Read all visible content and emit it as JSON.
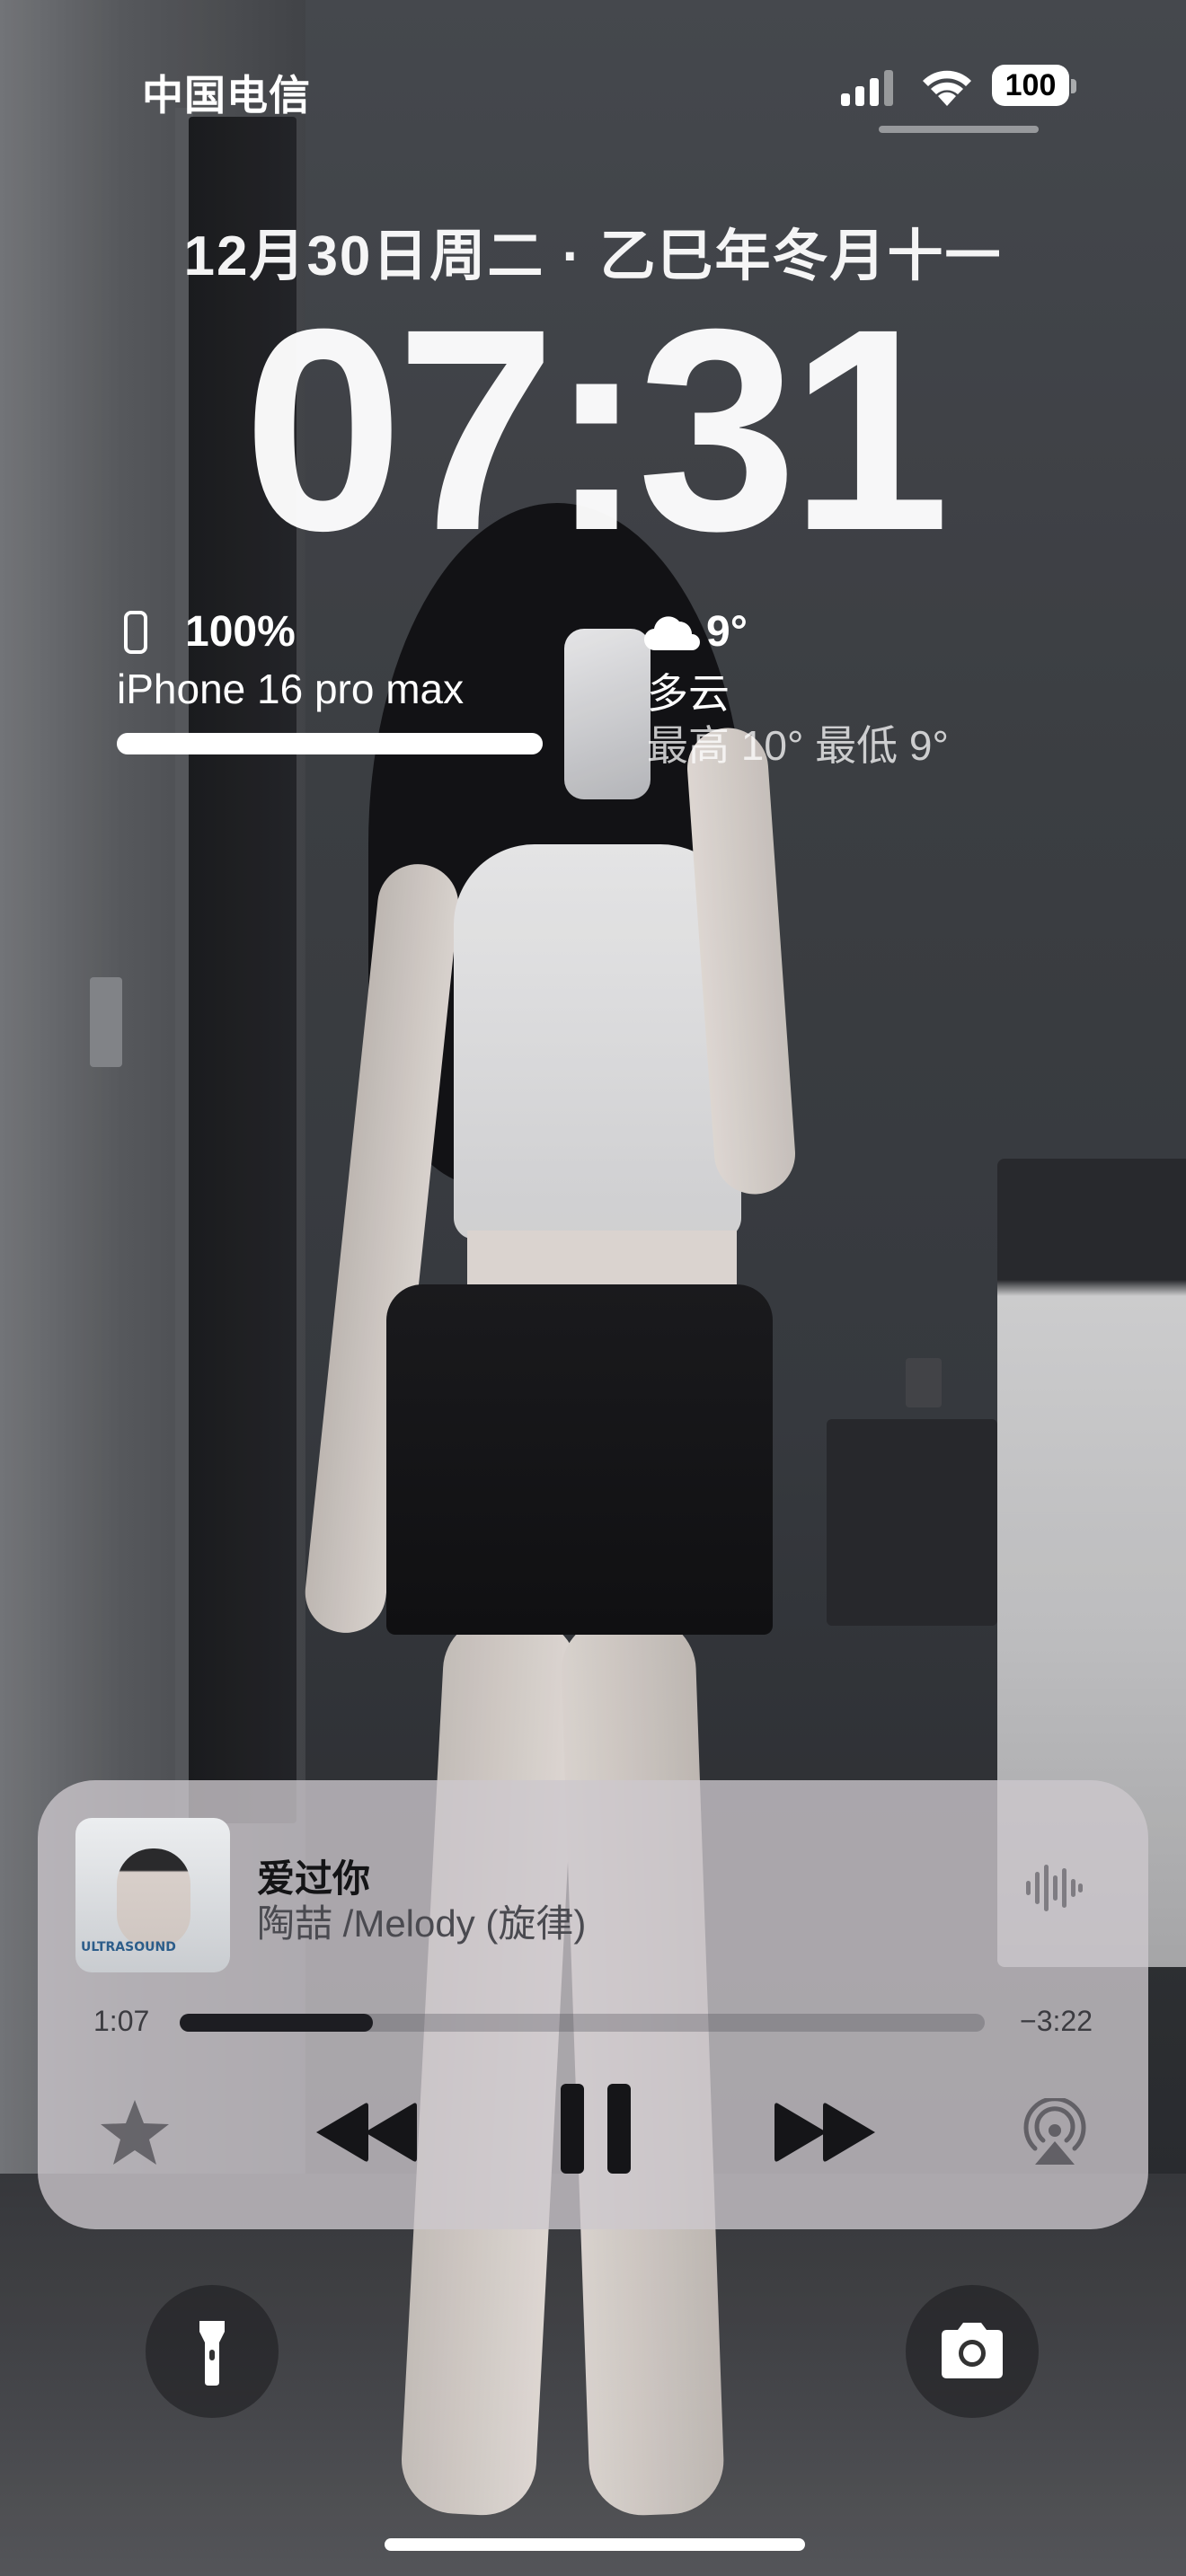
{
  "status_bar": {
    "carrier": "中国电信",
    "battery_level": "100"
  },
  "lockscreen": {
    "date": "12月30日周二 · 乙巳年冬月十一",
    "time": "07:31"
  },
  "battery_widget": {
    "percent": "100%",
    "device": "iPhone 16 pro max",
    "level_fraction": 1.0
  },
  "weather_widget": {
    "icon": "cloud-icon",
    "temperature": "9°",
    "condition": "多云",
    "high_low": "最高 10° 最低 9°"
  },
  "now_playing": {
    "song": "爱过你",
    "artist": "陶喆 /Melody (旋律)",
    "elapsed": "1:07",
    "remaining": "−3:22",
    "progress_fraction": 0.24,
    "artwork_label": "ULTRASOUND"
  },
  "controls": {
    "favorite": "star-icon",
    "previous": "backward-icon",
    "pause": "pause-icon",
    "next": "forward-icon",
    "airplay": "airplay-icon"
  },
  "quick_actions": {
    "left": "flashlight-icon",
    "right": "camera-icon"
  }
}
